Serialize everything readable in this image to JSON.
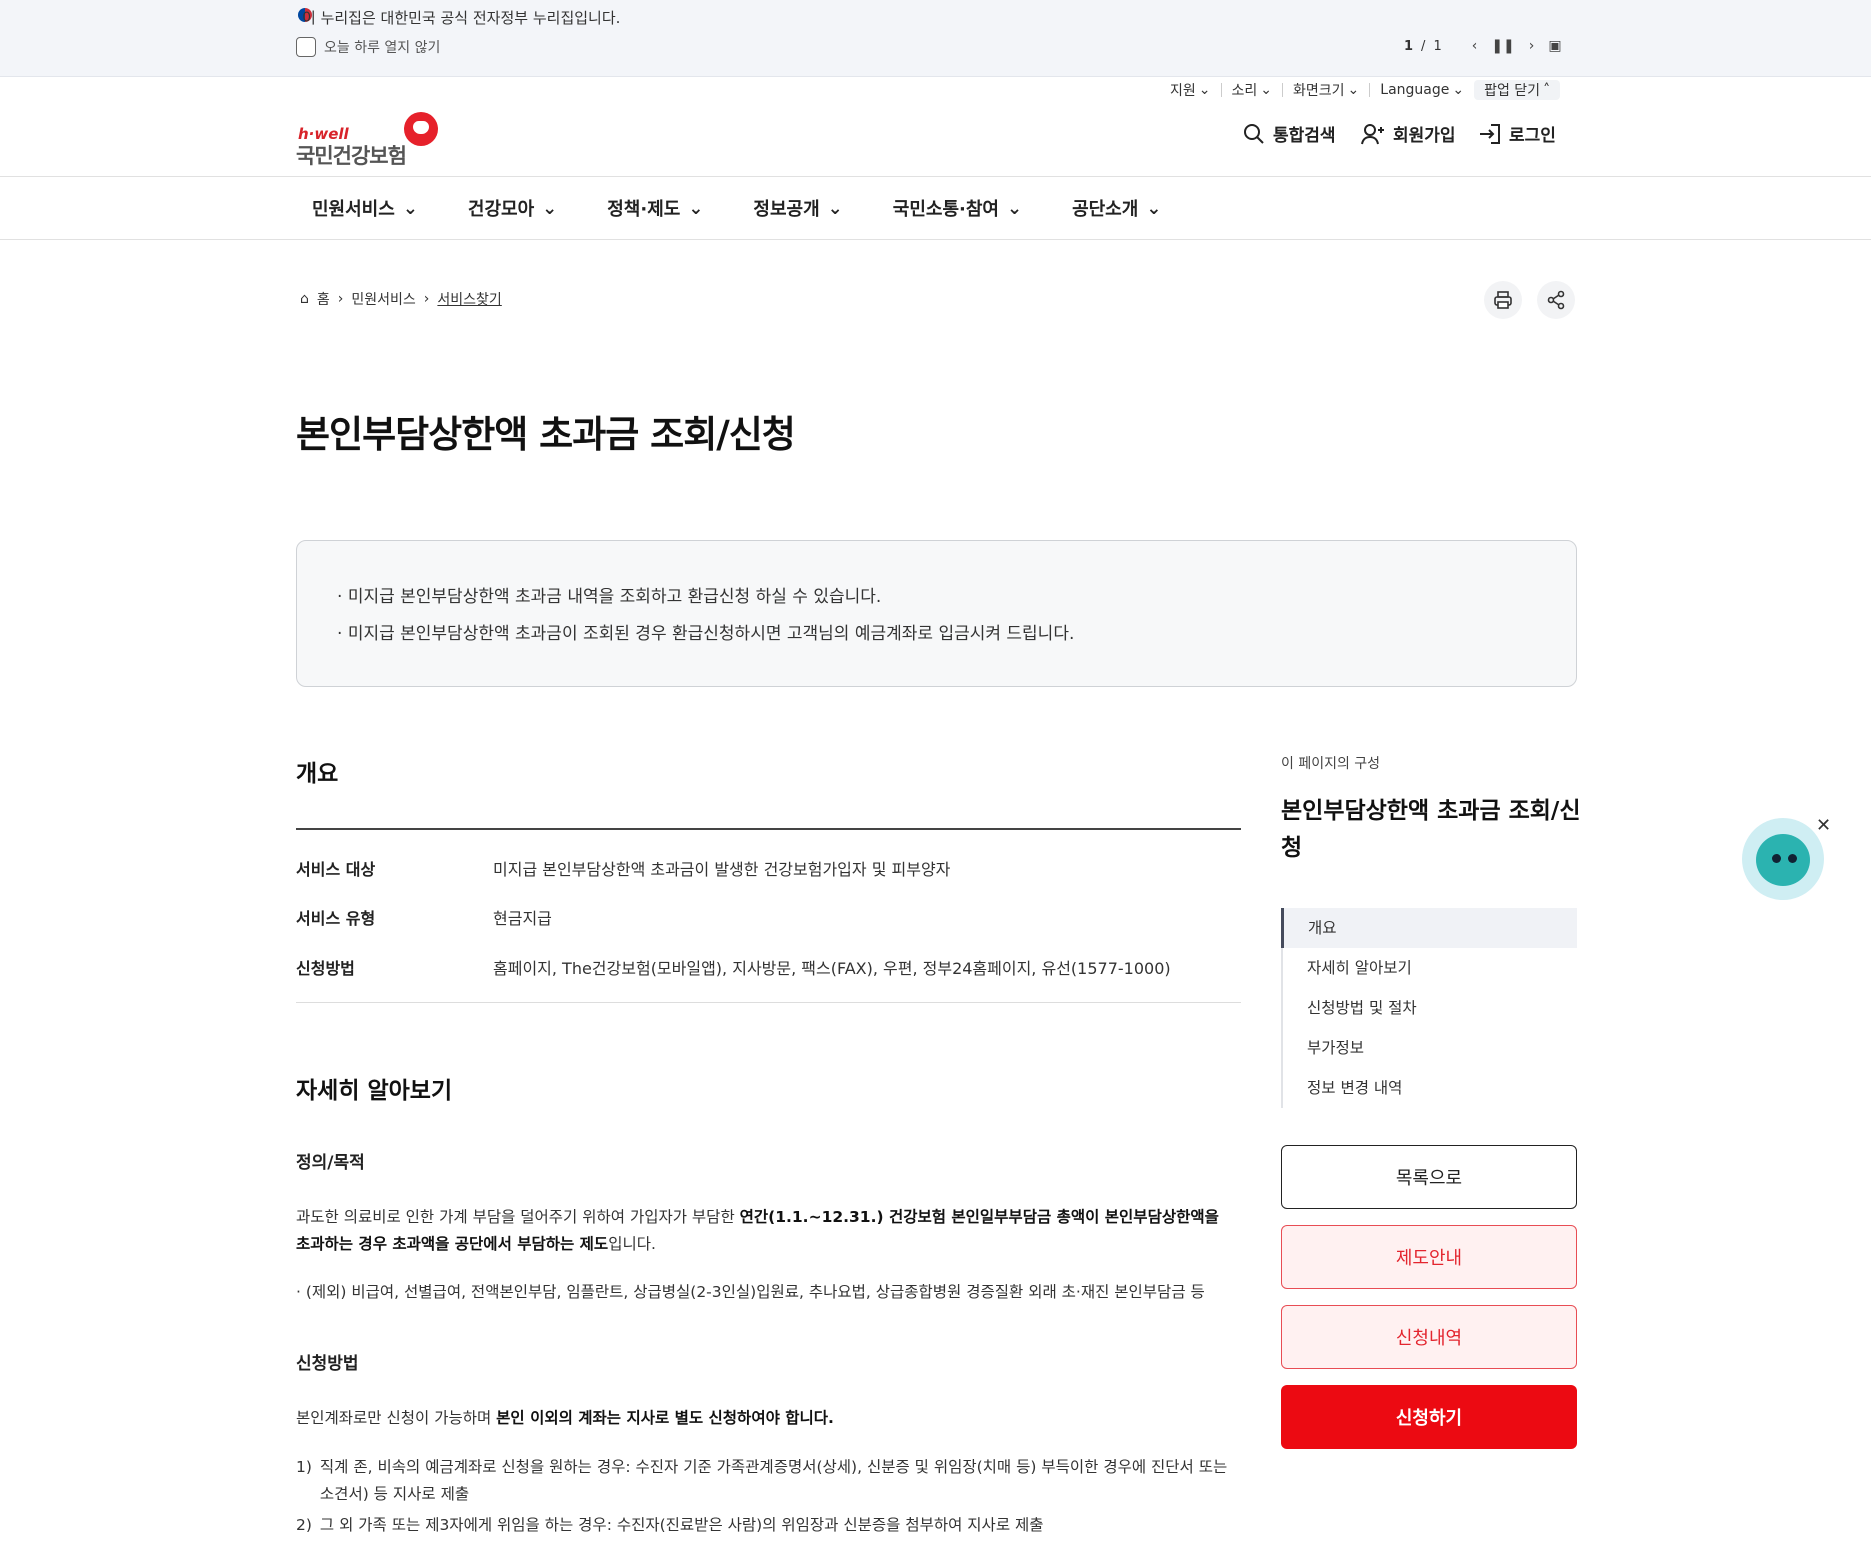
{
  "gov_banner": {
    "text": "이 누리집은 대한민국 공식 전자정부 누리집입니다.",
    "no_open_today": "오늘 하루 열지 않기",
    "page_current": "1",
    "page_sep": "/",
    "page_total": "1"
  },
  "utility": {
    "support": "지원",
    "sound": "소리",
    "screen_size": "화면크기",
    "language": "Language",
    "popup_close": "팝업 닫기"
  },
  "logo": {
    "en": "h·well",
    "ko": "국민건강보험"
  },
  "header_actions": {
    "search": "통합검색",
    "join": "회원가입",
    "login": "로그인"
  },
  "gnb": [
    "민원서비스",
    "건강모아",
    "정책·제도",
    "정보공개",
    "국민소통·참여",
    "공단소개"
  ],
  "breadcrumb": {
    "home": "홈",
    "level1": "민원서비스",
    "current": "서비스찾기"
  },
  "page": {
    "title": "본인부담상한액 초과금 조회/신청",
    "intro": [
      "미지급 본인부담상한액 초과금 내역을 조회하고 환급신청 하실 수 있습니다.",
      "미지급 본인부담상한액 초과금이 조회된 경우 환급신청하시면 고객님의 예금계좌로 입금시켜 드립니다."
    ]
  },
  "overview": {
    "heading": "개요",
    "rows": [
      {
        "key": "서비스 대상",
        "value": "미지급 본인부담상한액 초과금이 발생한 건강보험가입자 및 피부양자"
      },
      {
        "key": "서비스 유형",
        "value": "현금지급"
      },
      {
        "key": "신청방법",
        "value": "홈페이지, The건강보험(모바일앱), 지사방문, 팩스(FAX), 우편, 정부24홈페이지, 유선(1577-1000)"
      }
    ]
  },
  "details": {
    "heading": "자세히 알아보기",
    "def_heading": "정의/목적",
    "def_text_1": "과도한 의료비로 인한 가계 부담을 덜어주기 위하여 가입자가 부담한 ",
    "def_bold": "연간(1.1.~12.31.) 건강보험 본인일부부담금 총액이 본인부담상한액을 초과하는 경우 초과액을 공단에서 부담하는 제도",
    "def_text_2": "입니다.",
    "exclude": "(제외) 비급여, 선별급여, 전액본인부담, 임플란트, 상급병실(2-3인실)입원료, 추나요법, 상급종합병원 경증질환 외래 초·재진 본인부담금 등",
    "method_heading": "신청방법",
    "method_text": "본인계좌로만 신청이 가능하며 ",
    "method_bold": "본인 이외의 계좌는 지사로 별도 신청하여야 합니다.",
    "items": [
      {
        "num": "1)",
        "text": "직계 존, 비속의 예금계좌로 신청을 원하는 경우: 수진자 기준 가족관계증명서(상세), 신분증 및 위임장(치매 등) 부득이한 경우에 진단서 또는 소견서) 등 지사로 제출"
      },
      {
        "num": "2)",
        "text": "그 외 가족 또는 제3자에게 위임을 하는 경우: 수진자(진료받은 사람)의 위임장과 신분증을 첨부하여 지사로 제출"
      }
    ]
  },
  "toc": {
    "caption": "이 페이지의 구성",
    "title": "본인부담상한액 초과금 조회/신청",
    "items": [
      "개요",
      "자세히 알아보기",
      "신청방법 및 절차",
      "부가정보",
      "정보 변경 내역"
    ]
  },
  "buttons": {
    "list": "목록으로",
    "guide": "제도안내",
    "history": "신청내역",
    "apply": "신청하기"
  },
  "colors": {
    "brand_red": "#ec0a12",
    "accent_red_text": "#e3252e",
    "chatbot": "#2bb3b0"
  }
}
